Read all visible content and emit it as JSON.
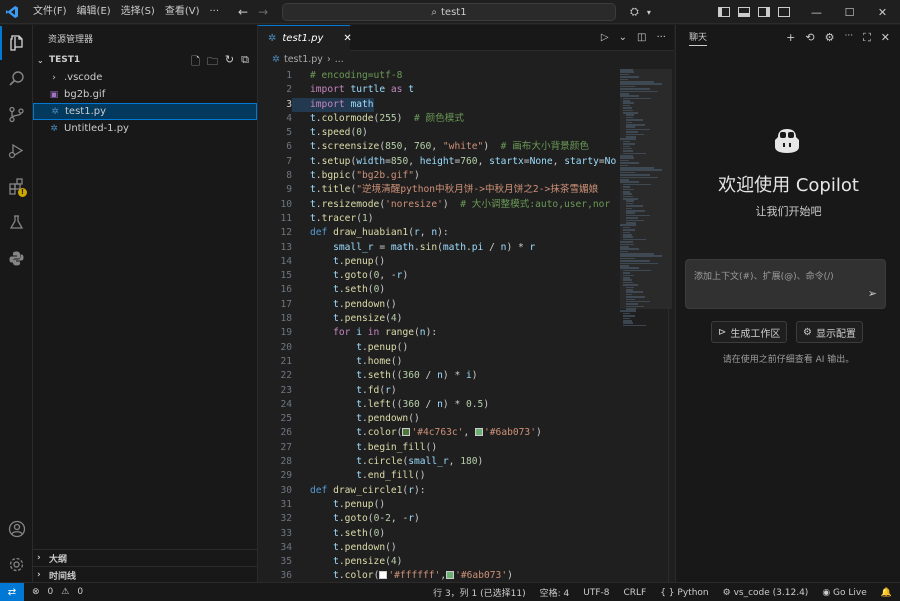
{
  "titlebar": {
    "menu": [
      "文件(F)",
      "编辑(E)",
      "选择(S)",
      "查看(V)",
      "···"
    ],
    "search_text": "test1"
  },
  "sidebar": {
    "title": "资源管理器",
    "folder": "TEST1",
    "items": [
      {
        "label": ".vscode",
        "icon": "chevron-right-icon",
        "type": "folder"
      },
      {
        "label": "bg2b.gif",
        "icon": "image-file-icon",
        "type": "file"
      },
      {
        "label": "test1.py",
        "icon": "python-file-icon",
        "type": "file",
        "selected": true
      },
      {
        "label": "Untitled-1.py",
        "icon": "python-file-icon",
        "type": "file"
      }
    ],
    "outline": "大纲",
    "timeline": "时间线"
  },
  "editor": {
    "tab_label": "test1.py",
    "breadcrumb_file": "test1.py",
    "breadcrumb_rest": "...",
    "current_line": 3,
    "lines": [
      "# encoding=utf-8",
      "import turtle as t",
      "import math",
      "t.colormode(255)  # 颜色模式",
      "t.speed(0)",
      "t.screensize(850, 760, \"white\")  # 画布大小背景颜色",
      "t.setup(width=850, height=760, startx=None, starty=No",
      "t.bgpic(\"bg2b.gif\")",
      "t.title(\"逆境清醒python中秋月饼->中秋月饼之2->抹茶雪媚娘",
      "t.resizemode('noresize')  # 大小调整模式:auto,user,nor",
      "t.tracer(1)",
      "def draw_huabian1(r, n):",
      "    small_r = math.sin(math.pi / n) * r",
      "    t.penup()",
      "    t.goto(0, -r)",
      "    t.seth(0)",
      "    t.pendown()",
      "    t.pensize(4)",
      "    for i in range(n):",
      "        t.penup()",
      "        t.home()",
      "        t.seth((360 / n) * i)",
      "        t.fd(r)",
      "        t.left((360 / n) * 0.5)",
      "        t.pendown()",
      "        t.color('#4c763c', '#6ab073')",
      "        t.begin_fill()",
      "        t.circle(small_r, 180)",
      "        t.end_fill()",
      "def draw_circle1(r):",
      "    t.penup()",
      "    t.goto(0-2, -r)",
      "    t.seth(0)",
      "    t.pendown()",
      "    t.pensize(4)",
      "    t.color('#ffffff','#6ab073')"
    ]
  },
  "chat": {
    "header": "聊天",
    "title": "欢迎使用 Copilot",
    "subtitle": "让我们开始吧",
    "input_placeholder": "添加上下文(#)、扩展(@)、命令(/)",
    "btn_workspace": "生成工作区",
    "btn_config": "显示配置",
    "note": "请在使用之前仔细查看 AI 输出。"
  },
  "statusbar": {
    "errors": "0",
    "warnings": "0",
    "position": "行 3，列 1 (已选择11)",
    "spaces": "空格: 4",
    "encoding": "UTF-8",
    "eol": "CRLF",
    "language": "Python",
    "interpreter": "vs_code (3.12.4)",
    "golive": "Go Live"
  },
  "colors": {
    "accent": "#0078d4",
    "swatch_1": "#4c763c",
    "swatch_2": "#6ab073",
    "swatch_3": "#ffffff"
  }
}
